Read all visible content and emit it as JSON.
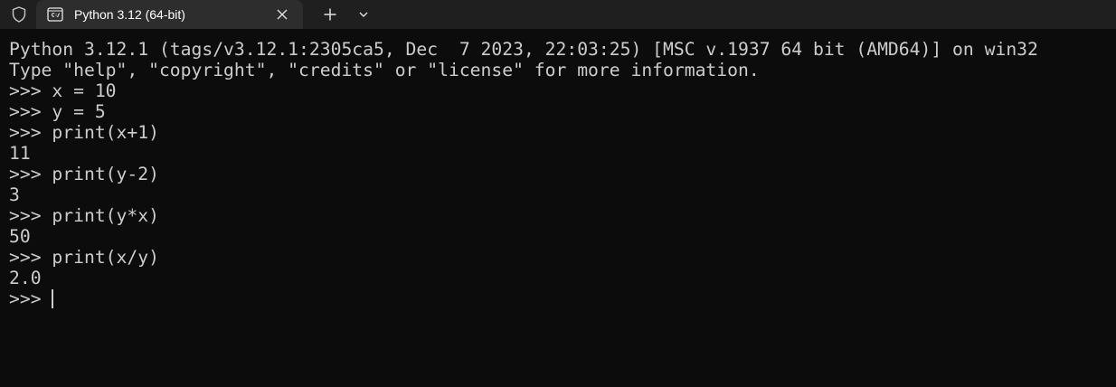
{
  "tab": {
    "title": "Python 3.12 (64-bit)"
  },
  "console": {
    "lines": [
      "Python 3.12.1 (tags/v3.12.1:2305ca5, Dec  7 2023, 22:03:25) [MSC v.1937 64 bit (AMD64)] on win32",
      "Type \"help\", \"copyright\", \"credits\" or \"license\" for more information.",
      ">>> x = 10",
      ">>> y = 5",
      ">>> print(x+1)",
      "11",
      ">>> print(y-2)",
      "3",
      ">>> print(y*x)",
      "50",
      ">>> print(x/y)",
      "2.0"
    ],
    "prompt": ">>> "
  },
  "colors": {
    "background": "#0c0c0c",
    "text": "#cccccc",
    "titlebar": "#1f1f1f",
    "active_tab": "#2d2d2d"
  },
  "icons": {
    "shield": "shield-icon",
    "terminal": "terminal-icon",
    "close": "close-icon",
    "new_tab": "plus-icon",
    "dropdown": "chevron-down-icon"
  }
}
